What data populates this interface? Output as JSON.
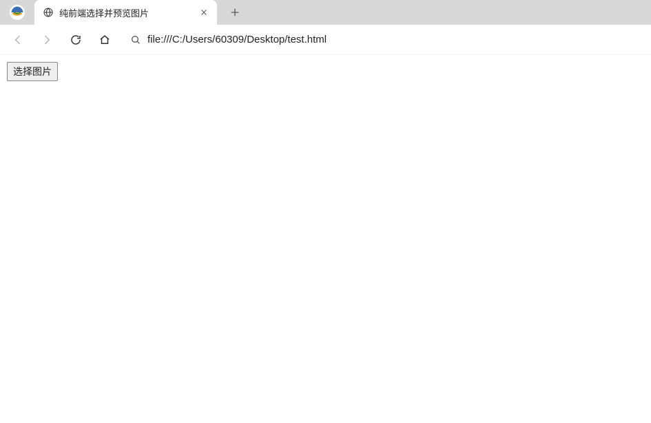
{
  "tab": {
    "title": "纯前端选择并预览图片"
  },
  "address": {
    "url": "file:///C:/Users/60309/Desktop/test.html"
  },
  "page": {
    "select_button_label": "选择图片"
  }
}
